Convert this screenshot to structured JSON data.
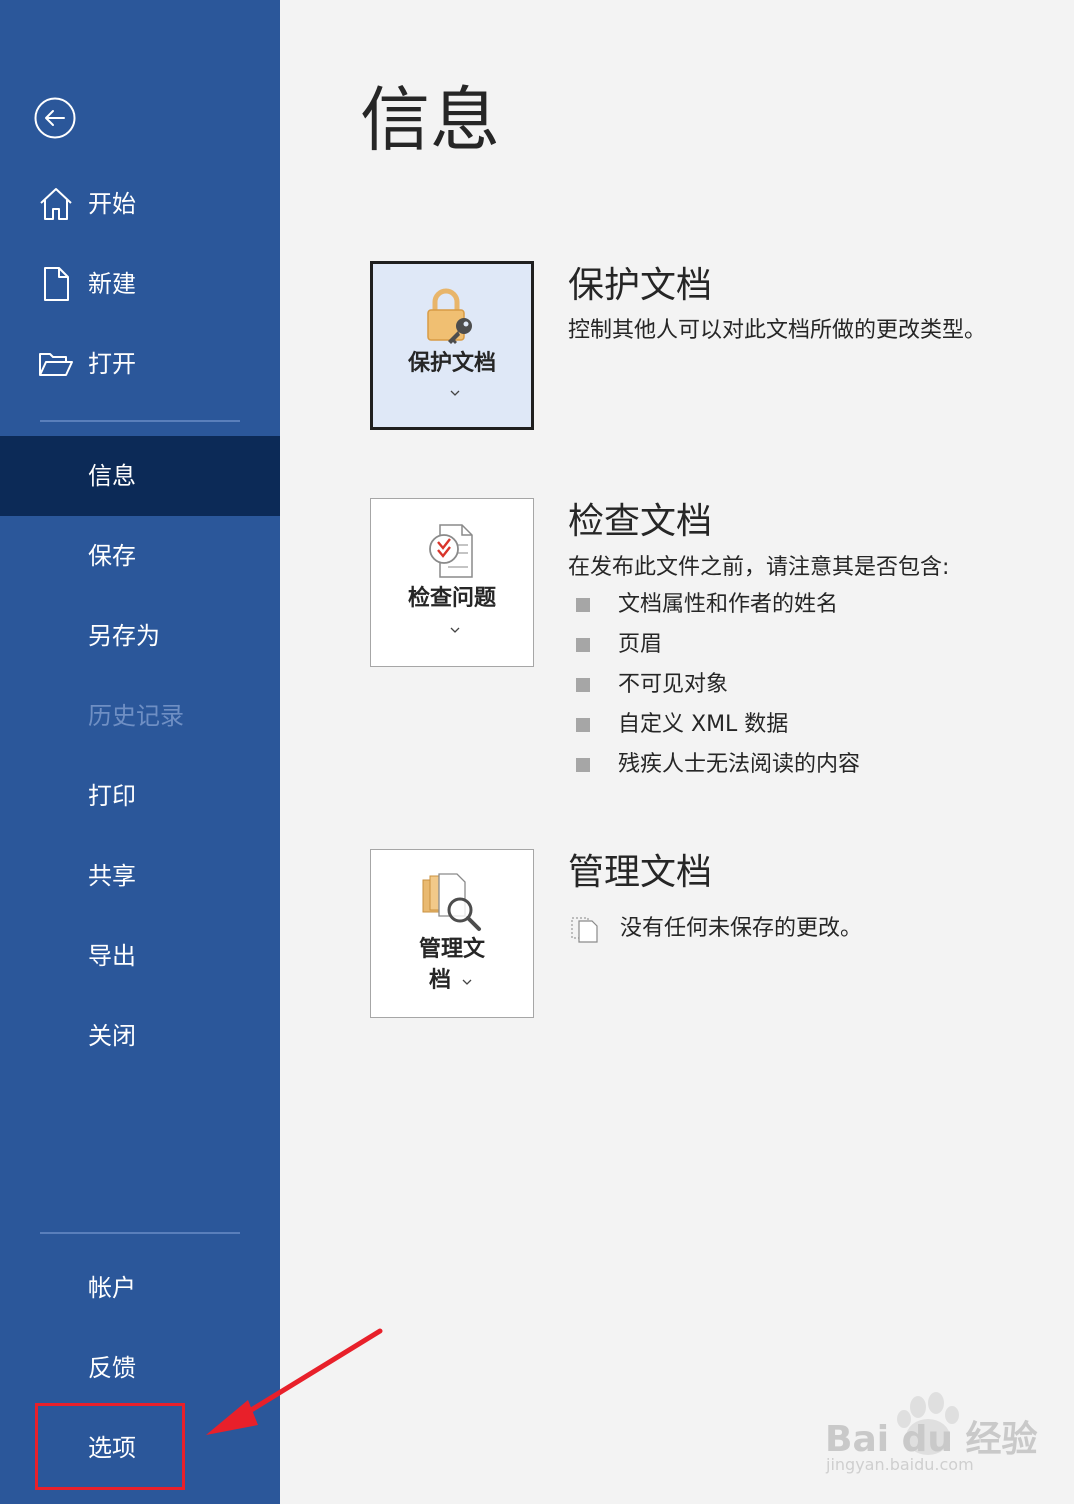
{
  "sidebar": {
    "back_label": "",
    "items": [
      {
        "key": "home",
        "label": "开始",
        "icon": "home-icon"
      },
      {
        "key": "new",
        "label": "新建",
        "icon": "new-document-icon"
      },
      {
        "key": "open",
        "label": "打开",
        "icon": "folder-open-icon"
      },
      {
        "key": "info",
        "label": "信息",
        "active": true
      },
      {
        "key": "save",
        "label": "保存"
      },
      {
        "key": "save_as",
        "label": "另存为"
      },
      {
        "key": "history",
        "label": "历史记录",
        "disabled": true
      },
      {
        "key": "print",
        "label": "打印"
      },
      {
        "key": "share",
        "label": "共享"
      },
      {
        "key": "export",
        "label": "导出"
      },
      {
        "key": "close",
        "label": "关闭"
      },
      {
        "key": "account",
        "label": "帐户"
      },
      {
        "key": "feedback",
        "label": "反馈"
      },
      {
        "key": "options",
        "label": "选项",
        "highlighted": true
      }
    ],
    "colors": {
      "background": "#2b579a",
      "active": "#0c2a57",
      "highlight": "#e8202a"
    }
  },
  "main": {
    "title": "信息",
    "sections": [
      {
        "key": "protect",
        "tile_label": "保护文档",
        "tile_icon": "lock-key-icon",
        "title": "保护文档",
        "description": "控制其他人可以对此文档所做的更改类型。"
      },
      {
        "key": "inspect",
        "tile_label": "检查问题",
        "tile_icon": "inspect-document-icon",
        "title": "检查文档",
        "description": "在发布此文件之前，请注意其是否包含:",
        "bullets": [
          "文档属性和作者的姓名",
          "页眉",
          "不可见对象",
          "自定义 XML 数据",
          "残疾人士无法阅读的内容"
        ]
      },
      {
        "key": "manage",
        "tile_label_line1": "管理文",
        "tile_label_line2": "档",
        "tile_icon": "manage-documents-icon",
        "title": "管理文档",
        "description": "没有任何未保存的更改。"
      }
    ]
  },
  "watermark": {
    "text": "Bai du 经验",
    "sub": "jingyan.baidu.com"
  }
}
